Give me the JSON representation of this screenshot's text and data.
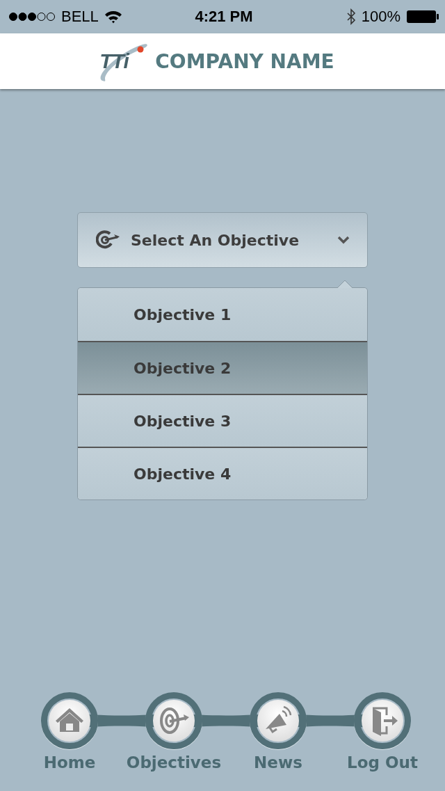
{
  "status_bar": {
    "carrier": "BELL",
    "time": "4:21 PM",
    "battery": "100%"
  },
  "header": {
    "logo_text": "TTi",
    "company_name": "COMPANY NAME"
  },
  "objective_select": {
    "label": "Select An Objective",
    "expanded": true
  },
  "options": [
    {
      "label": "Objective 1",
      "selected": false
    },
    {
      "label": "Objective 2",
      "selected": true
    },
    {
      "label": "Objective 3",
      "selected": false
    },
    {
      "label": "Objective 4",
      "selected": false
    }
  ],
  "nav": [
    {
      "kind": "home",
      "label": "Home"
    },
    {
      "kind": "objectives",
      "label": "Objectives"
    },
    {
      "kind": "news",
      "label": "News"
    },
    {
      "kind": "logout",
      "label": "Log Out"
    }
  ]
}
